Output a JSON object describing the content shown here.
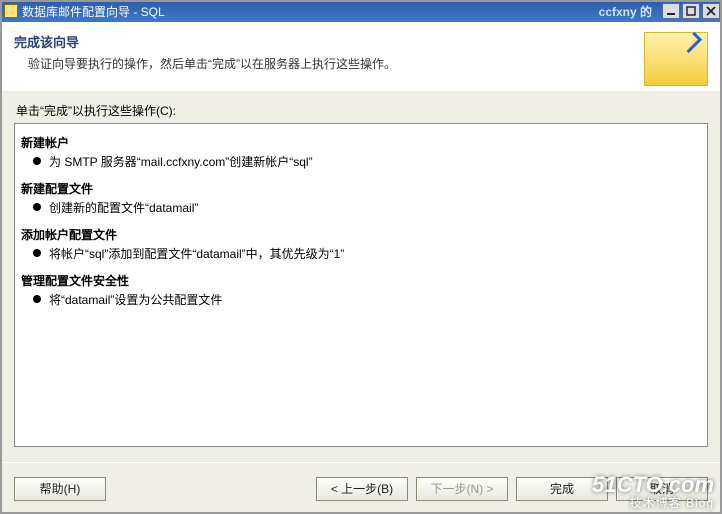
{
  "titlebar": {
    "title": "数据库邮件配置向导 - SQL",
    "user_tag": "ccfxny 的"
  },
  "header": {
    "title": "完成该向导",
    "subtitle": "验证向导要执行的操作，然后单击“完成”以在服务器上执行这些操作。"
  },
  "body": {
    "intro_label": "单击“完成”以执行这些操作(C):",
    "sections": [
      {
        "title": "新建帐户",
        "item": "为 SMTP 服务器“mail.ccfxny.com”创建新帐户“sql”"
      },
      {
        "title": "新建配置文件",
        "item": "创建新的配置文件“datamail”"
      },
      {
        "title": "添加帐户配置文件",
        "item": "将帐户“sql”添加到配置文件“datamail”中，其优先级为“1”"
      },
      {
        "title": "管理配置文件安全性",
        "item": "将“datamail”设置为公共配置文件"
      }
    ]
  },
  "buttons": {
    "help": "帮助(H)",
    "back": "< 上一步(B)",
    "next": "下一步(N) >",
    "finish": "完成",
    "cancel": "取消"
  },
  "watermark": {
    "big": "51CTO.com",
    "small": "技术博客  Blog"
  }
}
